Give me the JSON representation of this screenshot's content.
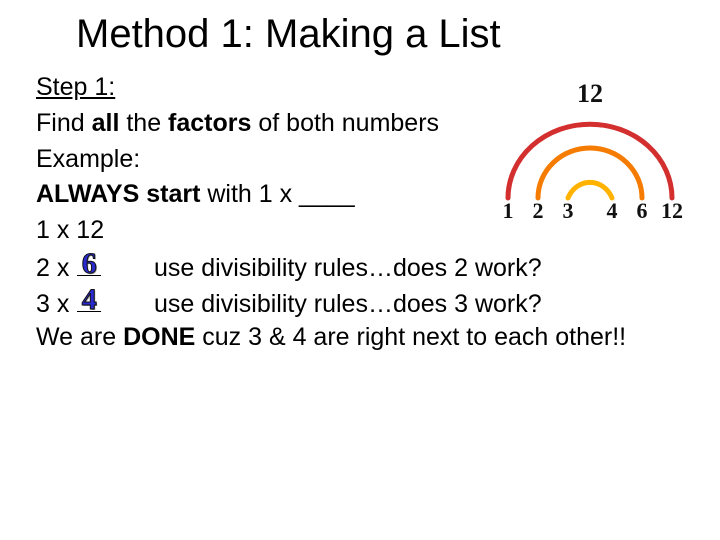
{
  "title": "Method 1: Making a List",
  "step_label": "Step 1:",
  "instruction_prefix": "Find ",
  "instruction_bold": "all ",
  "instruction_mid": "the ",
  "instruction_bold2": "factors",
  "instruction_suffix": " of both numbers",
  "example_label": " Example:",
  "always_prefix": "ALWAYS start",
  "always_suffix": " with 1 x ____",
  "line1": "1 x 12",
  "line2_lhs": "2 x ",
  "line2_answer": "6",
  "line2_note": "use divisibility rules…does 2 work?",
  "line3_lhs": "3 x ",
  "line3_answer": "4",
  "line3_note": "use divisibility rules…does 3 work?",
  "conclusion_prefix": "We are ",
  "conclusion_bold": "DONE",
  "conclusion_suffix": " cuz 3 & 4 are right next to each other!!",
  "diagram": {
    "top": "12",
    "bottom": [
      "1",
      "2",
      "3",
      "4",
      "6",
      "12"
    ],
    "arc_colors": [
      "#d32f2f",
      "#f57c00",
      "#ffb300"
    ]
  }
}
